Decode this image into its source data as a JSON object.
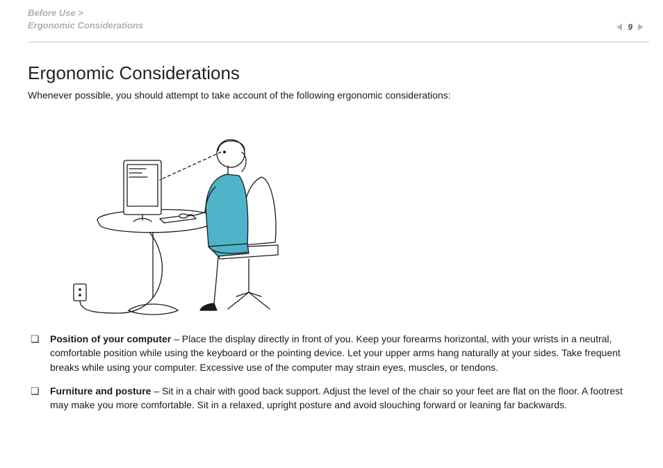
{
  "header": {
    "breadcrumb_top": "Before Use >",
    "breadcrumb_sub": "Ergonomic Considerations",
    "page_number": "9"
  },
  "main": {
    "title": "Ergonomic Considerations",
    "intro": "Whenever possible, you should attempt to take account of the following ergonomic considerations:",
    "bullets": [
      {
        "label": "Position of your computer",
        "text": " – Place the display directly in front of you. Keep your forearms horizontal, with your wrists in a neutral, comfortable position while using the keyboard or the pointing device. Let your upper arms hang naturally at your sides. Take frequent breaks while using your computer. Excessive use of the computer may strain eyes, muscles, or tendons."
      },
      {
        "label": "Furniture and posture",
        "text": " – Sit in a chair with good back support. Adjust the level of the chair so your feet are flat on the floor. A footrest may make you more comfortable. Sit in a relaxed, upright posture and avoid slouching forward or leaning far backwards."
      }
    ]
  },
  "illustration": {
    "name": "ergonomic-posture-illustration",
    "accent_color": "#4eb3c9"
  }
}
